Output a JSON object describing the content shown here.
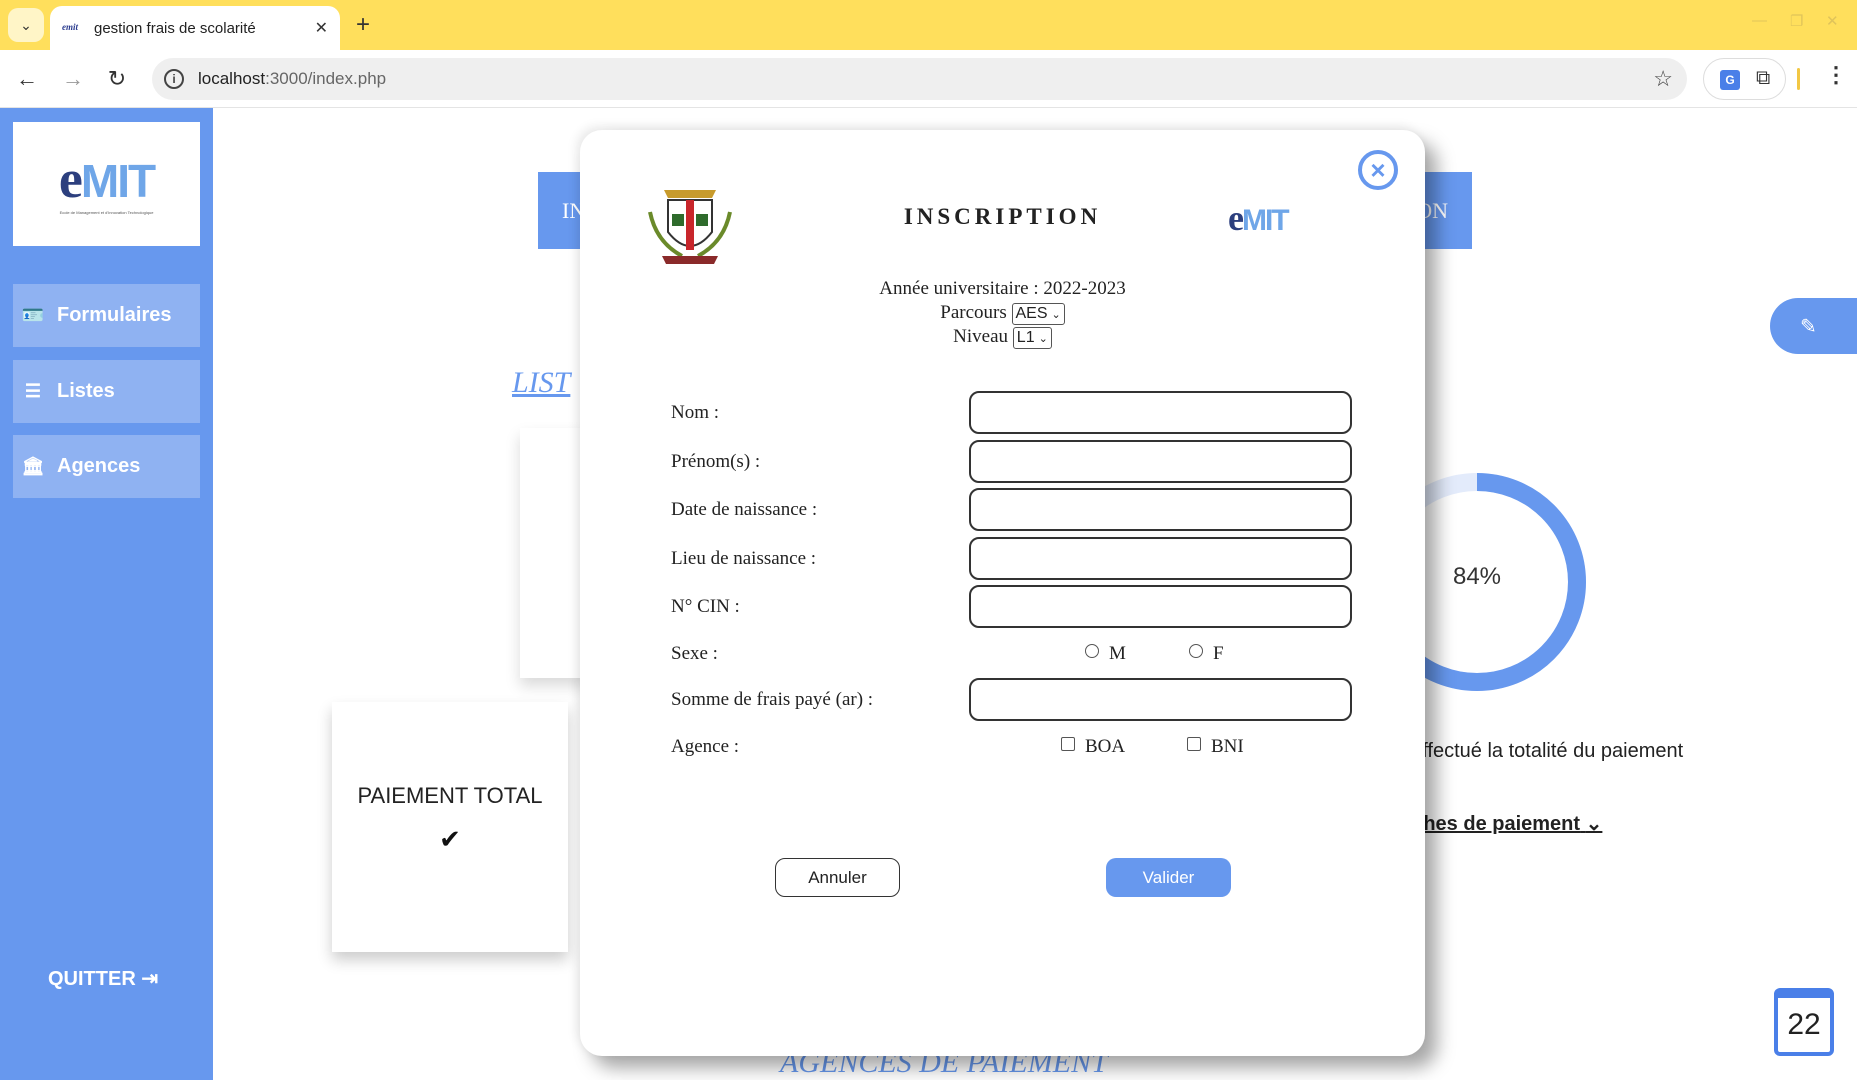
{
  "browser": {
    "tab_title": "gestion frais de scolarité",
    "favicon_text": "emit",
    "url_host": "localhost",
    "url_rest": ":3000/index.php"
  },
  "sidebar": {
    "logo_text_e": "e",
    "logo_text_mit": "MIT",
    "logo_sub": "Ecole de Management et d'Innovation Technologique",
    "items": [
      {
        "label": "Formulaires",
        "icon": "id-card-icon"
      },
      {
        "label": "Listes",
        "icon": "list-icon"
      },
      {
        "label": "Agences",
        "icon": "bank-icon"
      }
    ],
    "quit_label": "QUITTER"
  },
  "background": {
    "header_left": "IN",
    "header_right": "ON",
    "list_title": "LIST",
    "card_title": "PAIEMENT TOTAL",
    "donut_percent": 84,
    "donut_label": "84%",
    "text_payment": "t effectué la totalité du paiement",
    "text_tranches": "nches de paiement",
    "calendar_day": "22",
    "agences_title": "AGENCES DE PAIEMENT"
  },
  "modal": {
    "title": "INSCRIPTION",
    "annee_label": "Année universitaire : 2022-2023",
    "parcours_label": "Parcours",
    "parcours_value": "AES",
    "niveau_label": "Niveau",
    "niveau_value": "L1",
    "fields": {
      "nom": "Nom :",
      "prenom": "Prénom(s) :",
      "date": "Date de naissance :",
      "lieu": "Lieu de naissance :",
      "cin": "N° CIN :",
      "sexe": "Sexe :",
      "somme": "Somme de frais payé (ar) :",
      "agence": "Agence :"
    },
    "sexe_options": [
      "M",
      "F"
    ],
    "agence_options": [
      "BOA",
      "BNI"
    ],
    "cancel_label": "Annuler",
    "submit_label": "Valider",
    "colors": {
      "accent": "#6798ee"
    }
  }
}
